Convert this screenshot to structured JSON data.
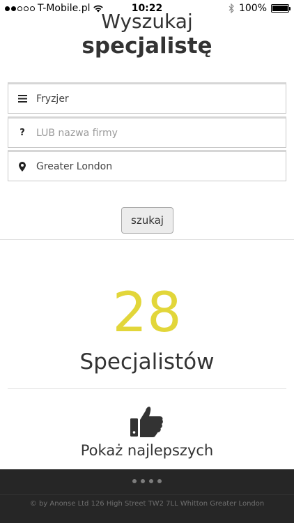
{
  "status_bar": {
    "carrier": "T-Mobile.pl",
    "time": "10:22",
    "battery_text": "100%",
    "battery_level": 1.0,
    "signal_bars_filled": 2,
    "signal_bars_total": 5,
    "icons": [
      "wifi-icon",
      "bluetooth-icon",
      "battery-icon"
    ]
  },
  "header": {
    "title_line1": "Wyszukaj",
    "title_line2": "specjalistę"
  },
  "form": {
    "category": {
      "value": "Fryzjer",
      "icon": "list-icon"
    },
    "company": {
      "placeholder": "LUB nazwa firmy",
      "icon": "question-icon"
    },
    "location": {
      "value": "Greater London",
      "icon": "map-pin-icon"
    },
    "search_label": "szukaj"
  },
  "results": {
    "count": "28",
    "label": "Specjalistów",
    "accent_color": "#e2d63a"
  },
  "best": {
    "icon": "thumbs-up-icon",
    "label": "Pokaż najlepszych"
  },
  "footer": {
    "text": "© by Anonse Ltd 126 High Street TW2 7LL Whitton Greater London",
    "background": "#262626"
  }
}
